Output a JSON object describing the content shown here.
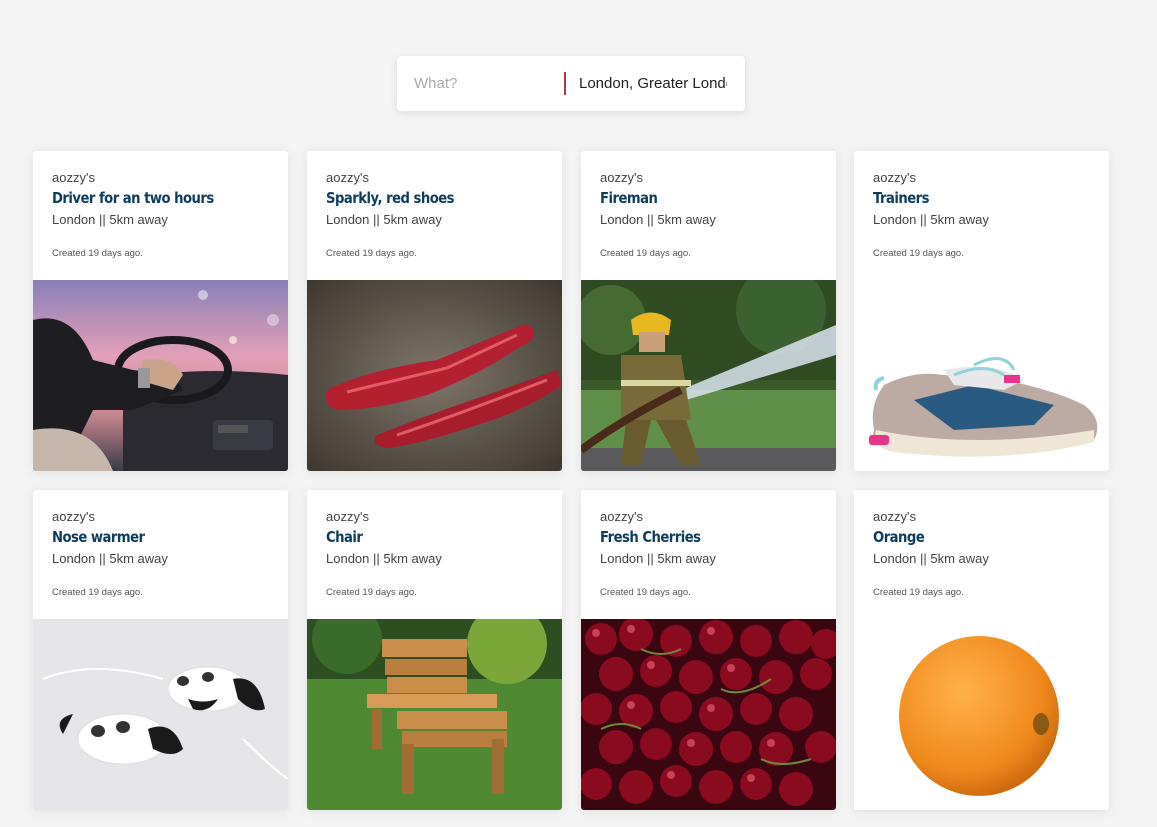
{
  "search": {
    "what_placeholder": "What?",
    "where_value": "London, Greater London"
  },
  "listings": [
    {
      "owner": "aozzy's",
      "title": "Driver for an two hours",
      "location": "London || 5km away",
      "created": "Created 19 days ago.",
      "image": "driver-photo"
    },
    {
      "owner": "aozzy's",
      "title": "Sparkly, red shoes",
      "location": "London || 5km away",
      "created": "Created 19 days ago.",
      "image": "red-shoes-photo"
    },
    {
      "owner": "aozzy's",
      "title": "Fireman",
      "location": "London || 5km away",
      "created": "Created 19 days ago.",
      "image": "fireman-photo"
    },
    {
      "owner": "aozzy's",
      "title": "Trainers",
      "location": "London || 5km away",
      "created": "Created 19 days ago.",
      "image": "trainers-photo"
    },
    {
      "owner": "aozzy's",
      "title": "Nose warmer",
      "location": "London || 5km away",
      "created": "Created 19 days ago.",
      "image": "nose-warmer-photo"
    },
    {
      "owner": "aozzy's",
      "title": "Chair",
      "location": "London || 5km away",
      "created": "Created 19 days ago.",
      "image": "chair-photo"
    },
    {
      "owner": "aozzy's",
      "title": "Fresh Cherries",
      "location": "London || 5km away",
      "created": "Created 19 days ago.",
      "image": "cherries-photo"
    },
    {
      "owner": "aozzy's",
      "title": "Orange",
      "location": "London || 5km away",
      "created": "Created 19 days ago.",
      "image": "orange-photo"
    }
  ],
  "colors": {
    "background": "#f4f4f4",
    "title": "#0d3d5c",
    "search_divider": "#b33a3a"
  }
}
